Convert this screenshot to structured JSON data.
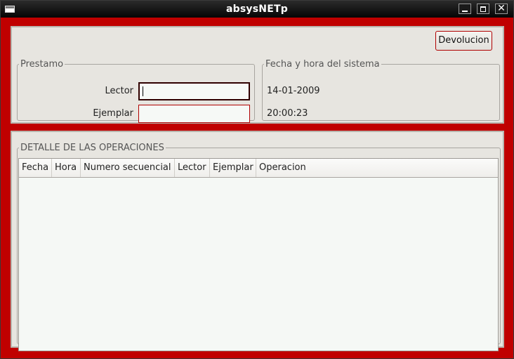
{
  "window": {
    "title": "absysNETp"
  },
  "buttons": {
    "devolucion": "Devolucion"
  },
  "prestamo": {
    "legend": "Prestamo",
    "lector_label": "Lector",
    "lector_value": "",
    "ejemplar_label": "Ejemplar",
    "ejemplar_value": ""
  },
  "sistema": {
    "legend": "Fecha y hora del sistema",
    "fecha": "14-01-2009",
    "hora": "20:00:23"
  },
  "detalle": {
    "legend": "DETALLE DE LAS OPERACIONES",
    "columns": [
      "Fecha",
      "Hora",
      "Numero secuencial",
      "Lector",
      "Ejemplar",
      "Operacion"
    ],
    "rows": []
  },
  "colors": {
    "frame": "#c00000",
    "panel": "#e7e5e0",
    "titlebar": "#000000"
  }
}
